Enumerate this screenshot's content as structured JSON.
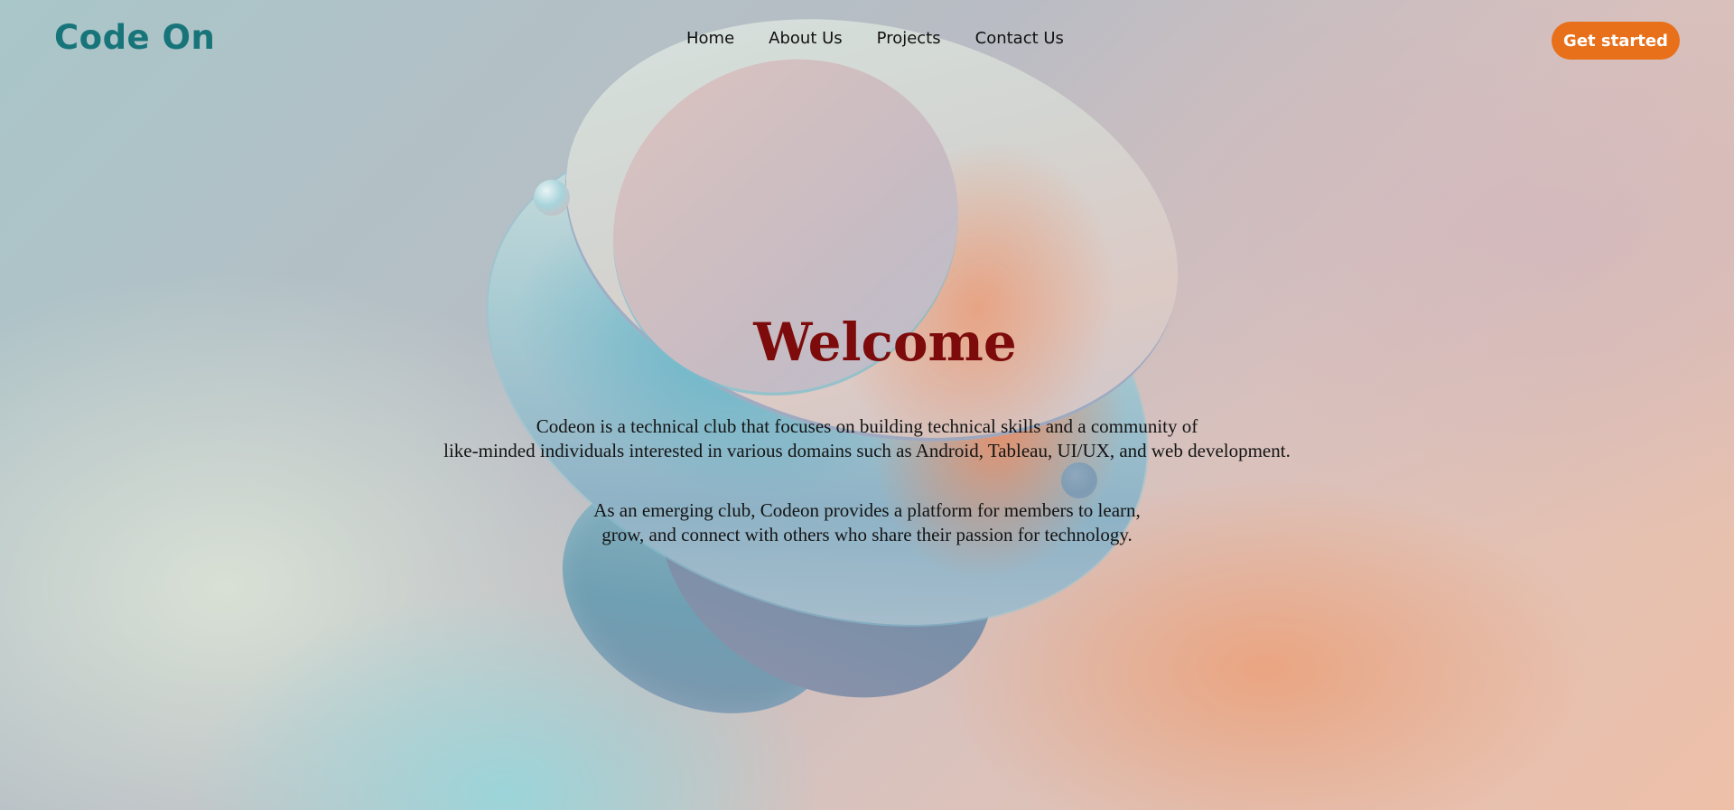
{
  "header": {
    "logo": "Code On",
    "nav": [
      {
        "label": "Home"
      },
      {
        "label": "About Us"
      },
      {
        "label": "Projects"
      },
      {
        "label": "Contact Us"
      }
    ],
    "cta_label": "Get started"
  },
  "hero": {
    "title": "Welcome",
    "paragraph1": [
      "Codeon is a technical club that focuses on building technical skills and a community of",
      "like-minded individuals interested in various domains such as Android, Tableau, UI/UX, and web development."
    ],
    "paragraph2": [
      "As an emerging club, Codeon provides a platform for members to learn,",
      "grow, and connect with others who share their passion for technology."
    ]
  },
  "colors": {
    "logo": "#17757a",
    "cta_background": "#e8701a",
    "title": "#7d0b0b"
  }
}
